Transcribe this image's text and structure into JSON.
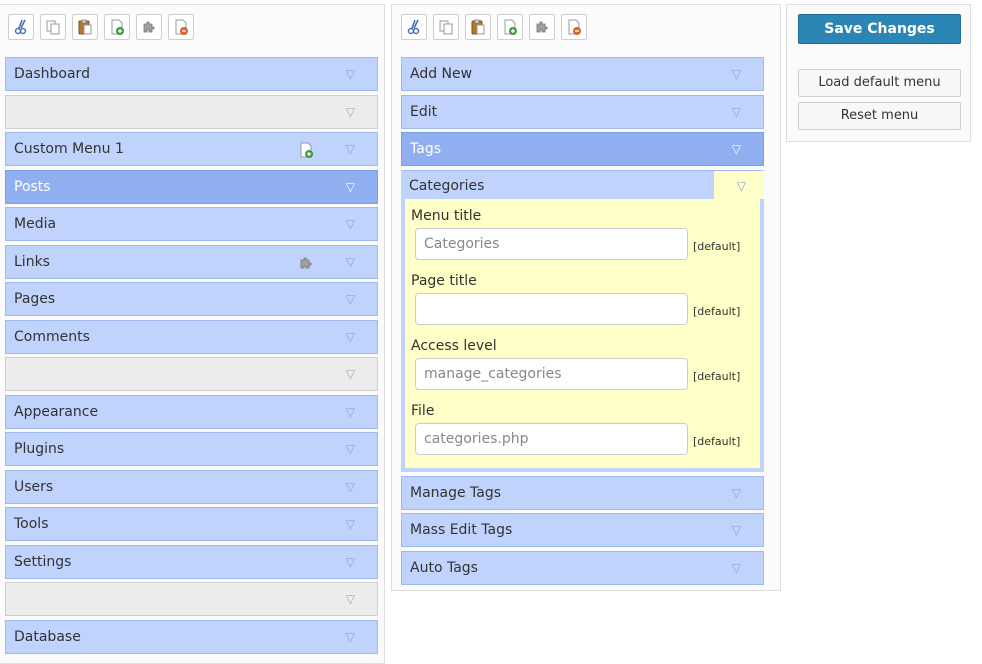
{
  "toolbar": {
    "buttons": [
      "cut",
      "copy",
      "paste",
      "new-menu",
      "new-separator",
      "delete"
    ]
  },
  "left_menu": {
    "items": [
      {
        "label": "Dashboard",
        "type": "item"
      },
      {
        "label": "",
        "type": "separator"
      },
      {
        "label": "Custom Menu 1",
        "type": "item",
        "mark": "new"
      },
      {
        "label": "Posts",
        "type": "item",
        "selected": true
      },
      {
        "label": "Media",
        "type": "item"
      },
      {
        "label": "Links",
        "type": "item",
        "mark": "plugin"
      },
      {
        "label": "Pages",
        "type": "item"
      },
      {
        "label": "Comments",
        "type": "item"
      },
      {
        "label": "",
        "type": "separator"
      },
      {
        "label": "Appearance",
        "type": "item"
      },
      {
        "label": "Plugins",
        "type": "item"
      },
      {
        "label": "Users",
        "type": "item"
      },
      {
        "label": "Tools",
        "type": "item"
      },
      {
        "label": "Settings",
        "type": "item"
      },
      {
        "label": "",
        "type": "separator"
      },
      {
        "label": "Database",
        "type": "item"
      }
    ]
  },
  "submenu": {
    "items_before": [
      {
        "label": "Add New"
      },
      {
        "label": "Edit"
      },
      {
        "label": "Tags",
        "selected": true
      }
    ],
    "expanded": {
      "label": "Categories",
      "fields": [
        {
          "label": "Menu title",
          "value": "Categories",
          "default": "[default]"
        },
        {
          "label": "Page title",
          "value": "",
          "default": "[default]"
        },
        {
          "label": "Access level",
          "value": "manage_categories",
          "default": "[default]"
        },
        {
          "label": "File",
          "value": "categories.php",
          "default": "[default]"
        }
      ]
    },
    "items_after": [
      {
        "label": "Manage Tags"
      },
      {
        "label": "Mass Edit Tags"
      },
      {
        "label": "Auto Tags"
      }
    ]
  },
  "actions": {
    "save": "Save Changes",
    "load_default": "Load default menu",
    "reset": "Reset menu"
  },
  "colors": {
    "item_bg": "#bfd3fd",
    "item_selected_bg": "#8faff0",
    "separator_bg": "#ececec",
    "expanded_bg": "#ffffc8",
    "save_button": "#2b86b5"
  },
  "toggle_glyph": "▽"
}
